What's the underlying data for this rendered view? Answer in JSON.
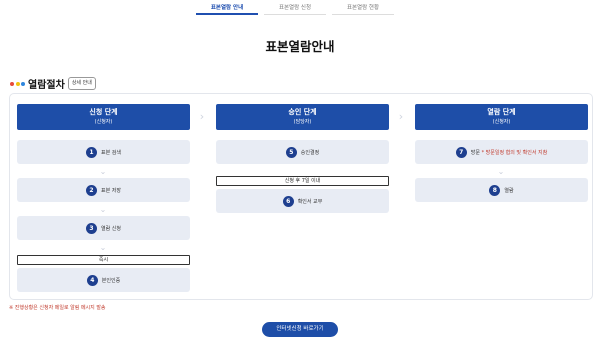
{
  "tabs": [
    {
      "label": "표본열람 안내",
      "active": true
    },
    {
      "label": "표본열람 신청",
      "active": false
    },
    {
      "label": "표본열람 현황",
      "active": false
    }
  ],
  "page_title": "표본열람안내",
  "section": {
    "title": "열람절차",
    "detail_button": "상세 안내",
    "dot_colors": [
      "#e74c3c",
      "#f1c40f",
      "#2e86de"
    ]
  },
  "stages": [
    {
      "name": "신청 단계",
      "sub": "(신청자)",
      "steps": [
        {
          "num": "1",
          "label": "표본 검색"
        },
        {
          "num": "2",
          "label": "표본 저장"
        },
        {
          "num": "3",
          "label": "열람 신청"
        },
        {
          "num": "4",
          "label": "본인인증"
        }
      ],
      "note": "즉시"
    },
    {
      "name": "승인 단계",
      "sub": "(담당자)",
      "steps": [
        {
          "num": "5",
          "label": "승인결정"
        },
        {
          "num": "6",
          "label": "확인서 교부"
        }
      ],
      "note": "신청 후 7일 이내"
    },
    {
      "name": "열람 단계",
      "sub": "(신청자)",
      "steps": [
        {
          "num": "7",
          "label": "방문",
          "label_red": "* 방문일정 협의 및 확인서 지참"
        },
        {
          "num": "8",
          "label": "열람"
        }
      ]
    }
  ],
  "footnote": "※ 진행상황은 신청자 메일로 알림 메시지 발송",
  "cta_label": "인터넷신청 바로가기",
  "colors": {
    "primary": "#1e4ea8",
    "step_bg": "#e8ecf4",
    "note_red": "#c0392b"
  }
}
